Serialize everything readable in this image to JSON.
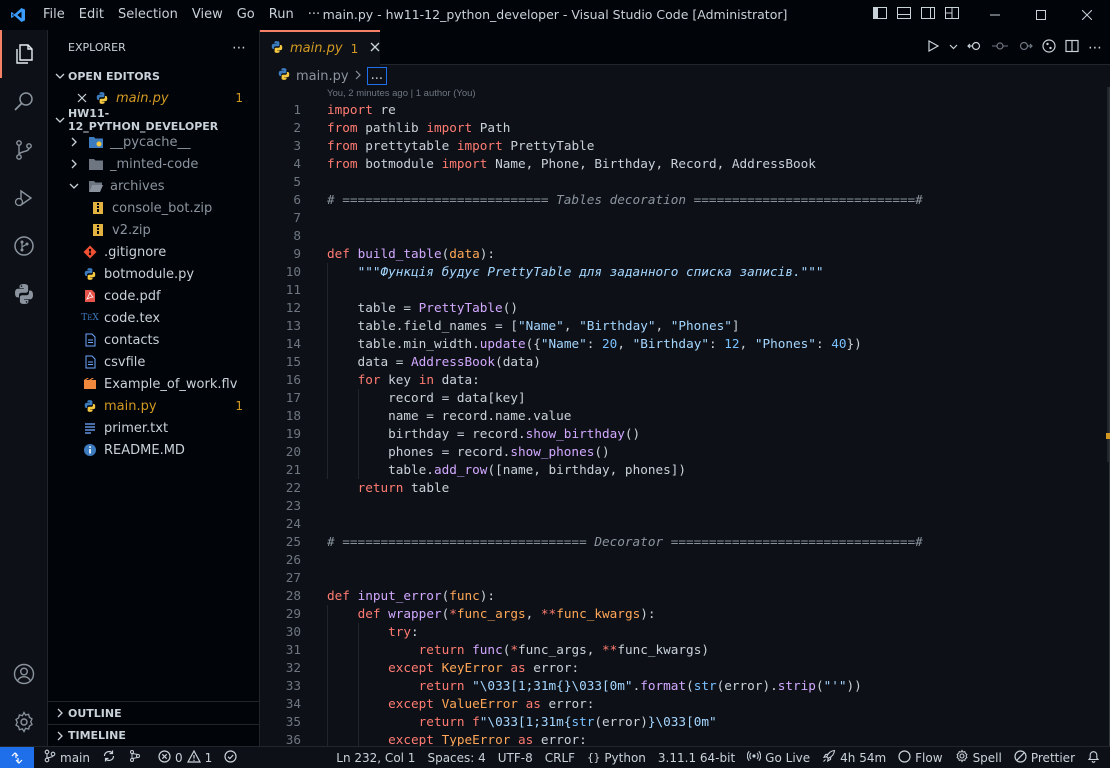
{
  "window": {
    "title": "main.py - hw11-12_python_developer - Visual Studio Code [Administrator]",
    "menu": [
      "File",
      "Edit",
      "Selection",
      "View",
      "Go",
      "Run",
      "···"
    ]
  },
  "sidebar": {
    "title": "EXPLORER",
    "open_editors": {
      "label": "OPEN EDITORS",
      "items": [
        {
          "name": "main.py",
          "badge": "1"
        }
      ]
    },
    "project": {
      "label": "HW11-12_PYTHON_DEVELOPER",
      "items": [
        {
          "name": "__pycache__",
          "kind": "folder",
          "icon": "python-folder-icon"
        },
        {
          "name": "_minted-code",
          "kind": "folder",
          "icon": "folder-icon"
        },
        {
          "name": "archives",
          "kind": "folder-open",
          "icon": "folder-open-icon"
        },
        {
          "name": "console_bot.zip",
          "kind": "file",
          "icon": "zip-icon"
        },
        {
          "name": "v2.zip",
          "kind": "file",
          "icon": "zip-icon"
        },
        {
          "name": ".gitignore",
          "kind": "file",
          "icon": "git-icon"
        },
        {
          "name": "botmodule.py",
          "kind": "file",
          "icon": "python-icon"
        },
        {
          "name": "code.pdf",
          "kind": "file",
          "icon": "pdf-icon"
        },
        {
          "name": "code.tex",
          "kind": "file",
          "icon": "tex-icon"
        },
        {
          "name": "contacts",
          "kind": "file",
          "icon": "file-icon"
        },
        {
          "name": "csvfile",
          "kind": "file",
          "icon": "file-icon"
        },
        {
          "name": "Example_of_work.flv",
          "kind": "file",
          "icon": "video-icon"
        },
        {
          "name": "main.py",
          "kind": "file",
          "icon": "python-icon",
          "badge": "1"
        },
        {
          "name": "primer.txt",
          "kind": "file",
          "icon": "text-icon"
        },
        {
          "name": "README.MD",
          "kind": "file",
          "icon": "info-icon"
        }
      ]
    },
    "outline_label": "OUTLINE",
    "timeline_label": "TIMELINE"
  },
  "tab": {
    "label": "main.py",
    "problems": "1"
  },
  "breadcrumb": {
    "file": "main.py",
    "more": "..."
  },
  "blame": "You, 2 minutes ago | 1 author (You)",
  "code_lines": [
    "1",
    "2",
    "3",
    "4",
    "5",
    "6",
    "7",
    "8",
    "9",
    "10",
    "11",
    "12",
    "13",
    "14",
    "15",
    "16",
    "17",
    "18",
    "19",
    "20",
    "21",
    "22",
    "23",
    "24",
    "25",
    "26",
    "27",
    "28",
    "29",
    "30",
    "31",
    "32",
    "33",
    "34",
    "35",
    "36"
  ],
  "status": {
    "branch": "main",
    "errors": "0",
    "warnings": "1",
    "position": "Ln 232, Col 1",
    "spaces": "Spaces: 4",
    "encoding": "UTF-8",
    "eol": "CRLF",
    "language": "Python",
    "interpreter": "3.11.1 64-bit",
    "live": "Go Live",
    "time": "4h 54m",
    "flow": "Flow",
    "spell": "Spell",
    "prettier": "Prettier"
  }
}
